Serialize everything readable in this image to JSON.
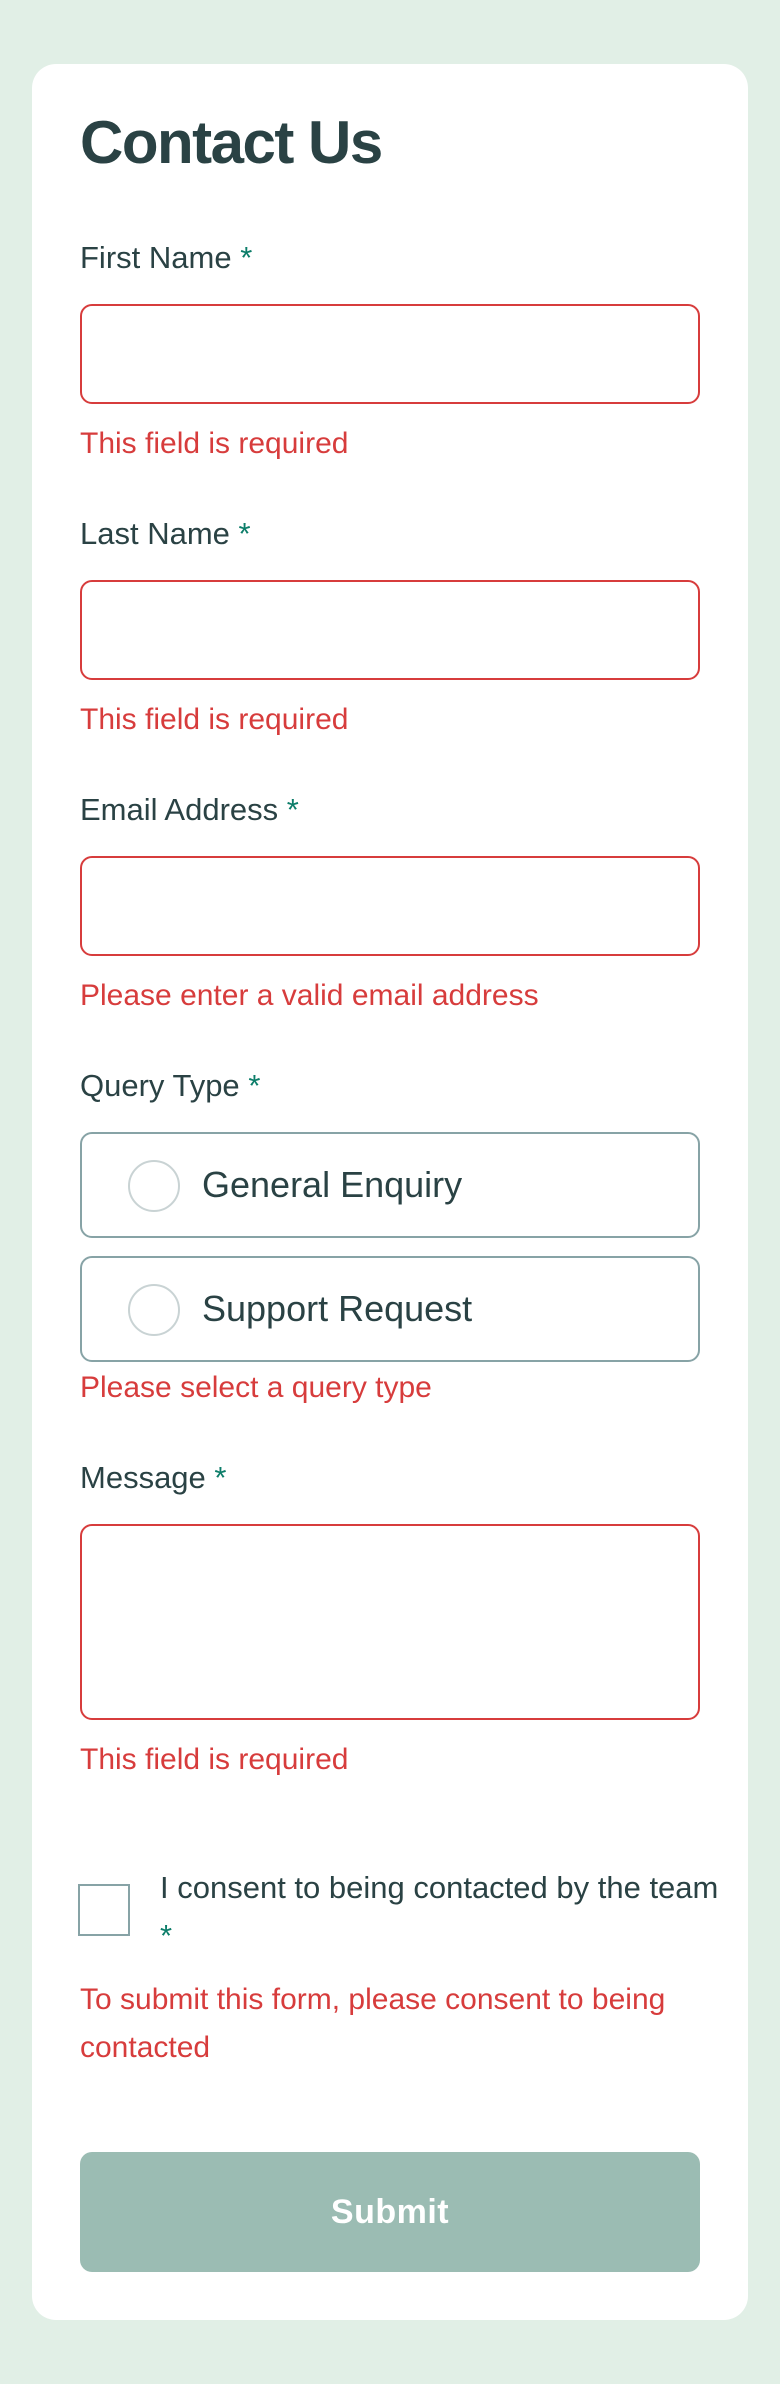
{
  "form": {
    "title": "Contact Us",
    "required_marker": "*",
    "first_name": {
      "label": "First Name",
      "value": "",
      "error": "This field is required"
    },
    "last_name": {
      "label": "Last Name",
      "value": "",
      "error": "This field is required"
    },
    "email": {
      "label": "Email Address",
      "value": "",
      "error": "Please enter a valid email address"
    },
    "query_type": {
      "label": "Query Type",
      "options": [
        "General Enquiry",
        "Support Request"
      ],
      "selected": null,
      "error": "Please select a query type"
    },
    "message": {
      "label": "Message",
      "value": "",
      "error": "This field is required"
    },
    "consent": {
      "label": "I consent to being contacted by the team",
      "checked": false,
      "error": "To submit this form, please consent to being contacted"
    },
    "submit_label": "Submit"
  },
  "colors": {
    "page_background": "#e1efe6",
    "card_background": "#ffffff",
    "text": "#2a4244",
    "error": "#d73c3c",
    "required_marker": "#0c7d69",
    "submit_background": "#9bbcb3"
  }
}
